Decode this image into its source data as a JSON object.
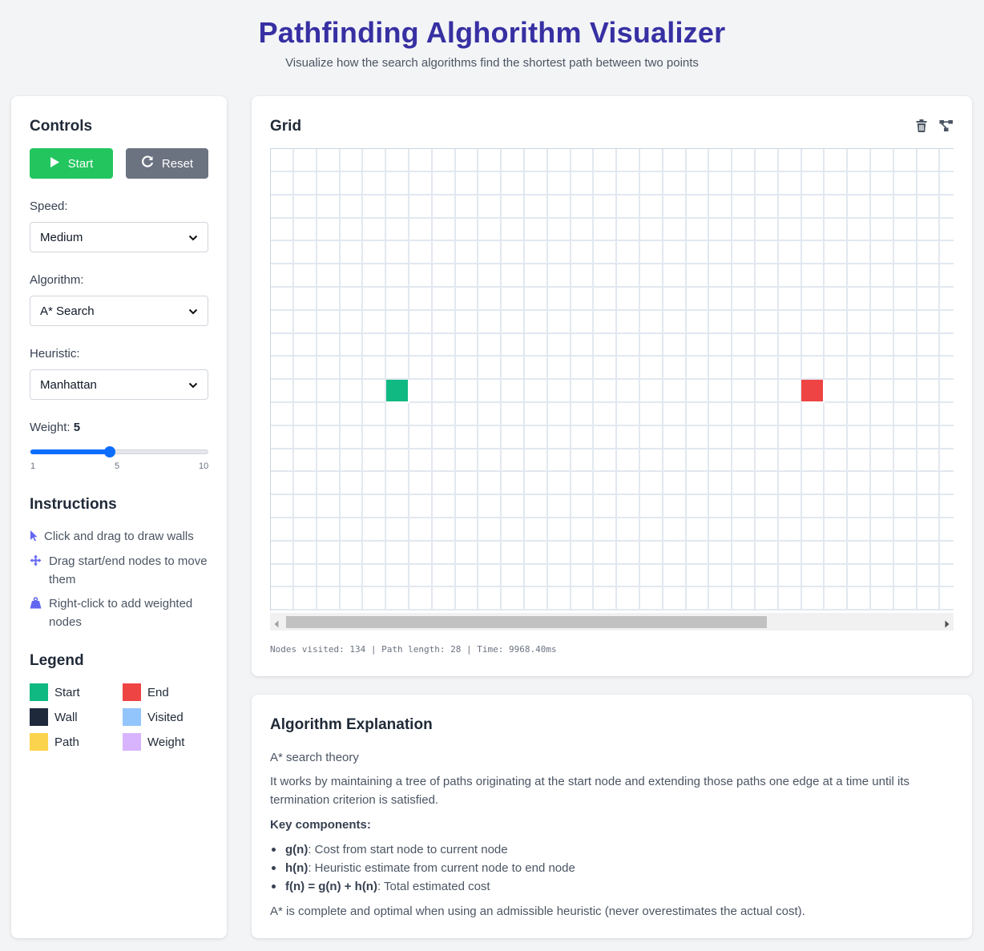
{
  "header": {
    "title": "Pathfinding Alghorithm Visualizer",
    "subtitle": "Visualize how the search algorithms find the shortest path between two points"
  },
  "controls": {
    "title": "Controls",
    "start_label": "Start",
    "reset_label": "Reset",
    "speed_label": "Speed:",
    "speed_value": "Medium",
    "algorithm_label": "Algorithm:",
    "algorithm_value": "A* Search",
    "heuristic_label": "Heuristic:",
    "heuristic_value": "Manhattan",
    "weight_label": "Weight:",
    "weight_value": "5",
    "weight_min": "1",
    "weight_mid": "5",
    "weight_max": "10",
    "weight_fraction": 0.4444
  },
  "instructions": {
    "title": "Instructions",
    "items": [
      {
        "icon": "cursor-icon",
        "text": "Click and drag to draw walls"
      },
      {
        "icon": "move-icon",
        "text": "Drag start/end nodes to move them"
      },
      {
        "icon": "weight-icon",
        "text": "Right-click to add weighted nodes"
      }
    ]
  },
  "legend": {
    "title": "Legend",
    "items": [
      {
        "label": "Start",
        "color": "#10b981"
      },
      {
        "label": "End",
        "color": "#ef4444"
      },
      {
        "label": "Wall",
        "color": "#1e293b"
      },
      {
        "label": "Visited",
        "color": "#93c5fd"
      },
      {
        "label": "Path",
        "color": "#fcd34d"
      },
      {
        "label": "Weight",
        "color": "#d8b4fe"
      }
    ]
  },
  "grid": {
    "title": "Grid",
    "toolbar_icons": [
      "trash-icon",
      "maze-icon"
    ],
    "visible_cols": 30,
    "visible_rows": 20,
    "start_node": {
      "row": 10,
      "col": 5
    },
    "end_node": {
      "row": 10,
      "col": 23
    },
    "stats": "Nodes visited: 134 | Path length: 28 | Time: 9968.40ms"
  },
  "explanation": {
    "title": "Algorithm Explanation",
    "theory": "A* search theory",
    "description": "It works by maintaining a tree of paths originating at the start node and extending those paths one edge at a time until its termination criterion is satisfied.",
    "key_title": "Key components:",
    "components": [
      {
        "term": "g(n)",
        "desc": ": Cost from start node to current node"
      },
      {
        "term": "h(n)",
        "desc": ": Heuristic estimate from current node to end node"
      },
      {
        "term": "f(n) = g(n) + h(n)",
        "desc": ": Total estimated cost"
      }
    ],
    "note": "A* is complete and optimal when using an admissible heuristic (never overestimates the actual cost)."
  },
  "colors": {
    "accent": "#3730a3",
    "start_button": "#22c55e",
    "reset_button": "#6b7280",
    "slider": "#0d6efd"
  }
}
